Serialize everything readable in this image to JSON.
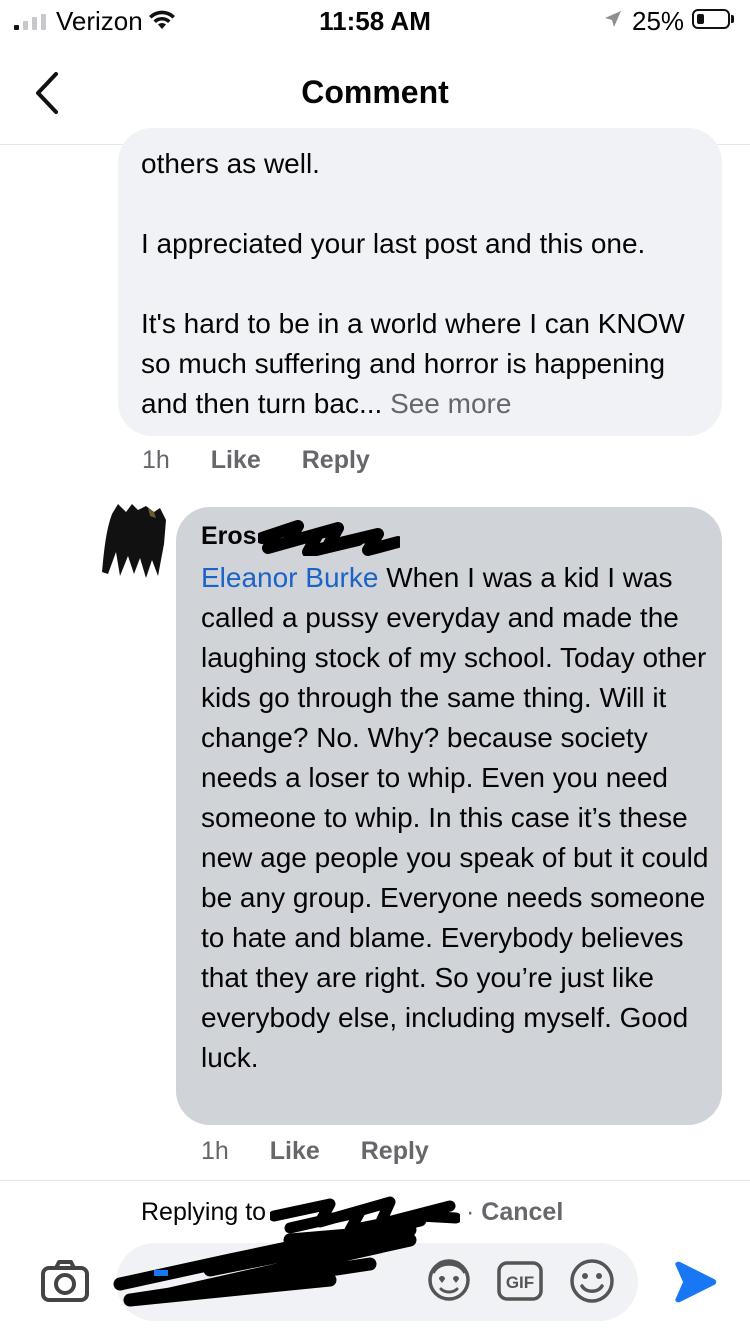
{
  "status_bar": {
    "carrier": "Verizon",
    "time": "11:58 AM",
    "battery_percent": "25%",
    "battery_level": 0.25
  },
  "header": {
    "title": "Comment"
  },
  "comment_1": {
    "paragraphs": [
      "others as well.",
      "I appreciated your last post and this one.",
      "It's hard to be in a world where I can KNOW so much suffering and horror is happening and then turn bac..."
    ],
    "see_more": "See more",
    "time": "1h",
    "like_label": "Like",
    "reply_label": "Reply"
  },
  "comment_2": {
    "author": "Eros",
    "mention": "Eleanor Burke",
    "text": "When I was a kid I was called a pussy everyday and made the laughing stock of my school. Today other kids go through the same thing. Will it change? No. Why? because society needs a loser to whip. Even you need someone to whip. In this case it’s these new age people you speak of but it could be any group. Everyone needs someone to hate and blame. Everybody believes that they are right. So you’re just like everybody else, including myself. Good luck.",
    "time": "1h",
    "like_label": "Like",
    "reply_label": "Reply"
  },
  "composer": {
    "replying_to_label": "Replying to",
    "separator": "·",
    "cancel_label": "Cancel",
    "input_value": ""
  },
  "colors": {
    "mention": "#1b63c7",
    "send": "#1877f2",
    "bubble_light": "#f0f2f5",
    "bubble_dark": "#d0d3d8",
    "meta": "#65676b"
  },
  "icons": {
    "back": "chevron-left-icon",
    "camera": "camera-icon",
    "avatar_sticker": "avatar-sticker-icon",
    "gif": "gif-icon",
    "emoji": "emoji-icon",
    "send": "send-arrow-icon"
  }
}
